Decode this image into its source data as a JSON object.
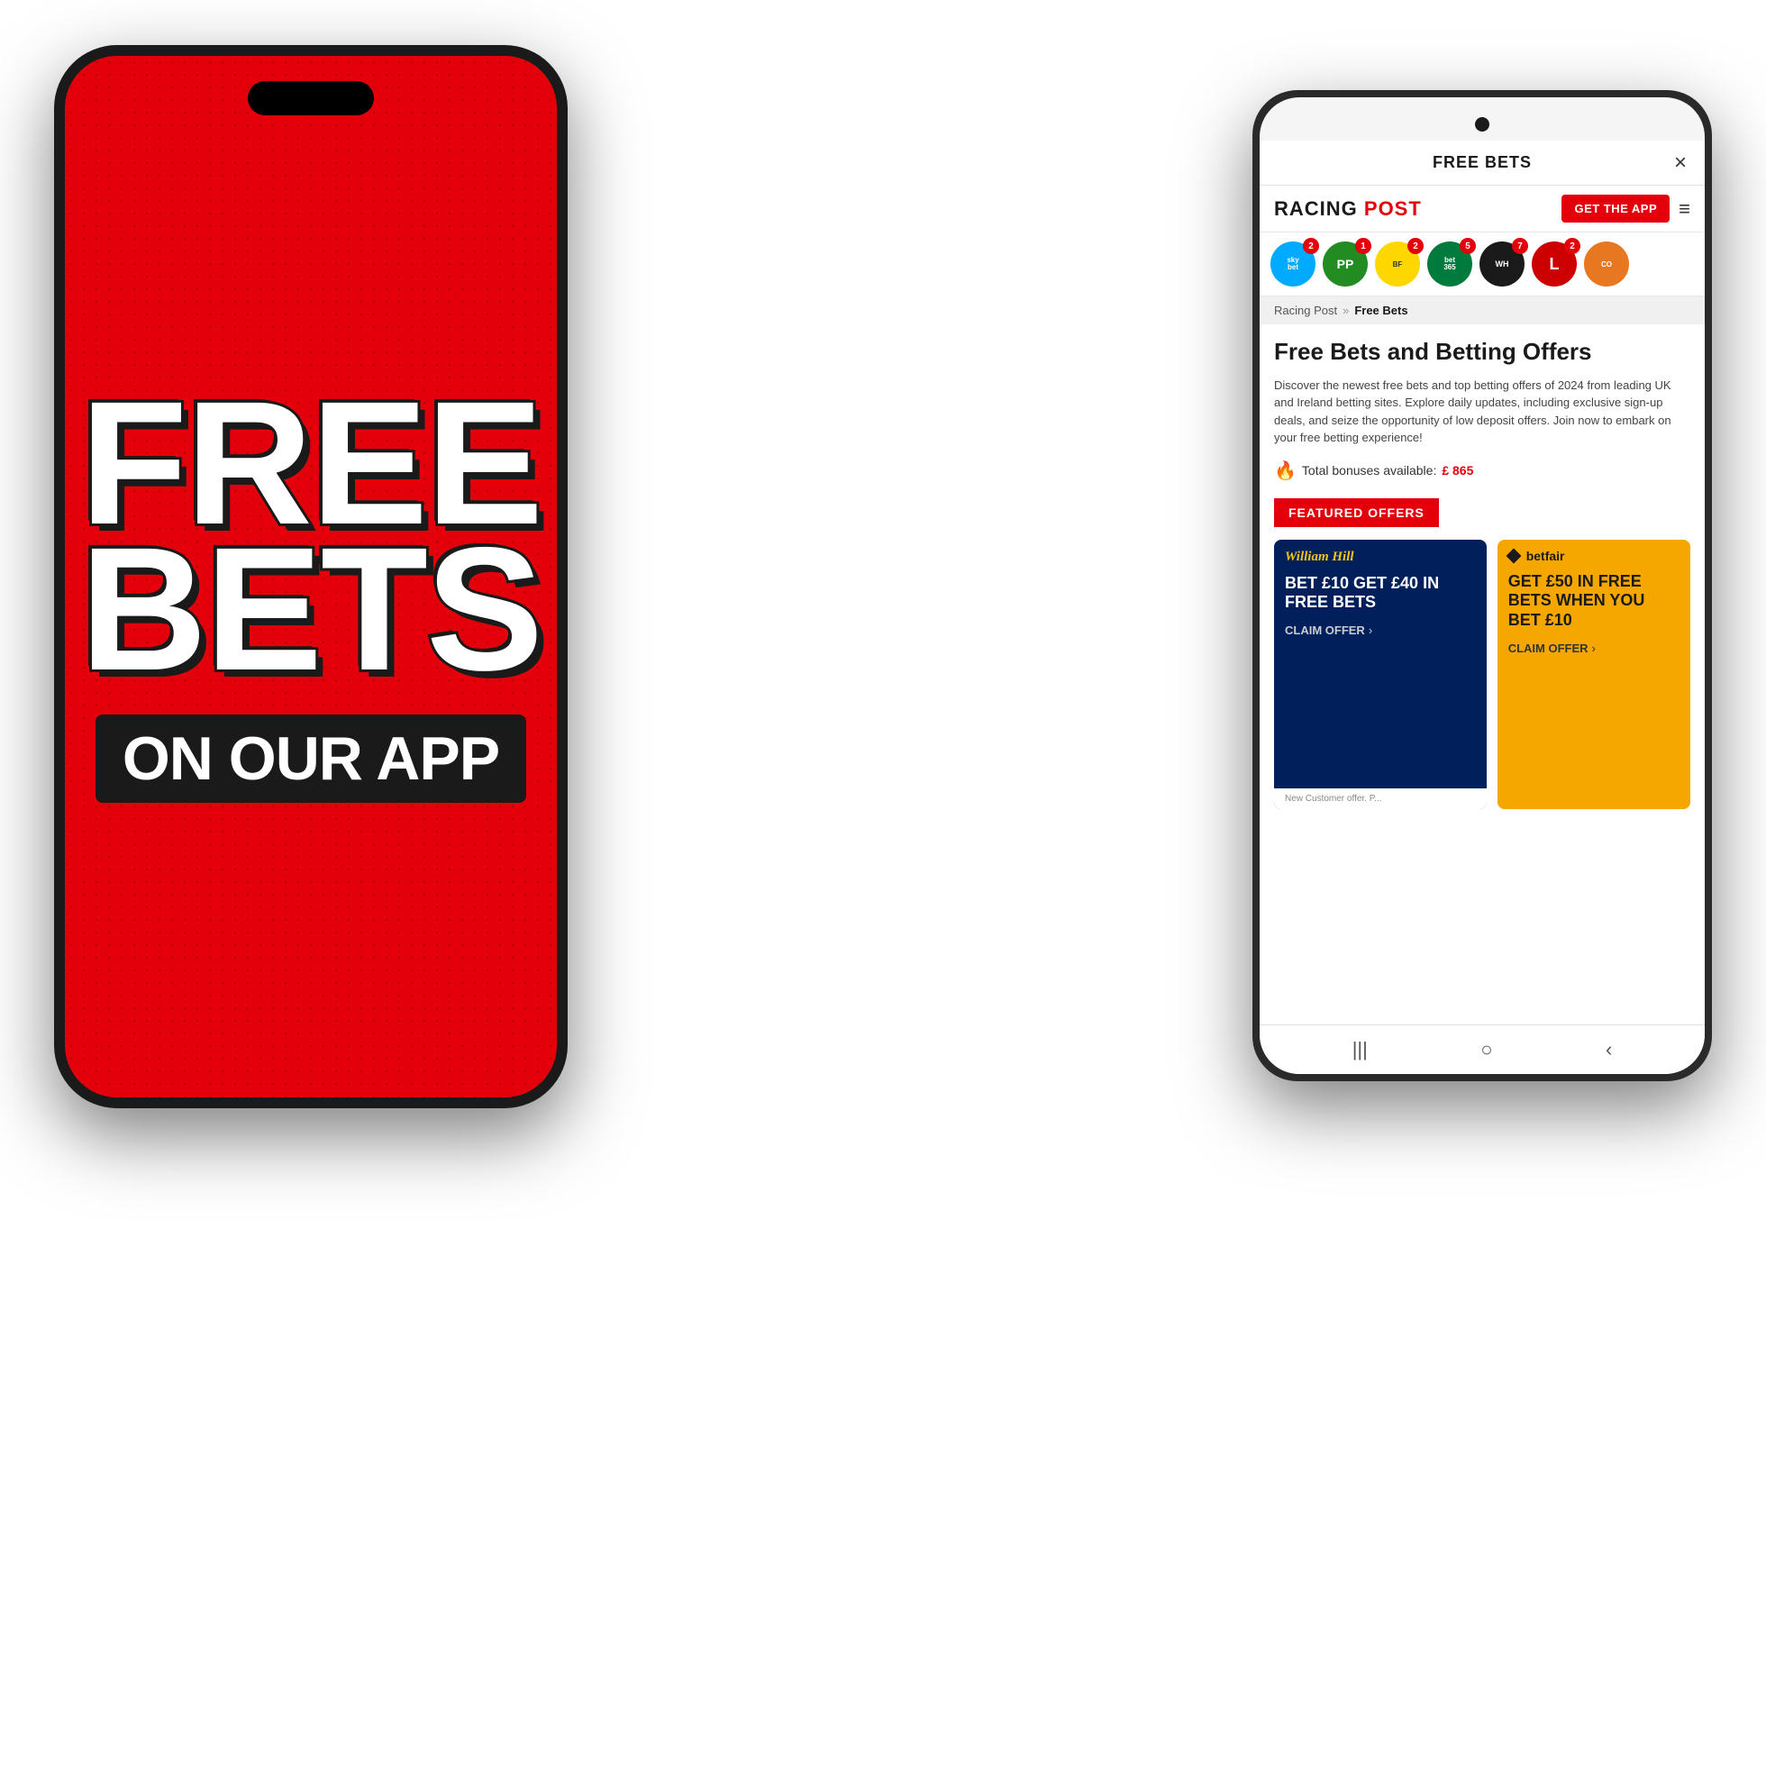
{
  "scene": {
    "background": "#ffffff"
  },
  "left_phone": {
    "background_color": "#e3000b",
    "line1": "FREE",
    "line2": "BETS",
    "line3": "ON OUR APP"
  },
  "right_phone": {
    "modal": {
      "title": "FREE BETS",
      "close_label": "×"
    },
    "navbar": {
      "brand": "RACING POST",
      "get_app_label": "GET THE APP",
      "menu_icon": "≡"
    },
    "bookies": [
      {
        "name": "Sky Bet",
        "short": "sky\nbet",
        "class": "bookie-sky",
        "badge": "2"
      },
      {
        "name": "Paddy Power",
        "short": "PP",
        "class": "bookie-pp",
        "badge": "1"
      },
      {
        "name": "Betfair",
        "short": "BF",
        "class": "bookie-betfair",
        "badge": "2"
      },
      {
        "name": "Bet365",
        "short": "bet\n365",
        "class": "bookie-bet365",
        "badge": "5"
      },
      {
        "name": "William Hill",
        "short": "WH",
        "class": "bookie-whill",
        "badge": "7"
      },
      {
        "name": "L",
        "short": "L",
        "class": "bookie-l",
        "badge": "2"
      },
      {
        "name": "Coral",
        "short": "CO",
        "class": "bookie-coral",
        "badge": ""
      }
    ],
    "breadcrumb": {
      "link": "Racing Post",
      "separator": "»",
      "current": "Free Bets"
    },
    "main": {
      "heading": "Free Bets and Betting Offers",
      "description": "Discover the newest free bets and top betting offers of 2024 from leading UK and Ireland betting sites. Explore daily updates, including exclusive sign-up deals, and seize the opportunity of low deposit offers. Join now to embark on your free betting experience!",
      "bonus_label": "Total bonuses available:",
      "bonus_amount": "£ 865",
      "featured_label": "FEATURED OFFERS"
    },
    "offers": [
      {
        "id": "whill",
        "logo": "William Hill",
        "title": "BET £10 GET £40 IN FREE BETS",
        "claim": "CLAIM OFFER",
        "footer": "New Customer offer. P..."
      },
      {
        "id": "betfair",
        "logo": "betfair",
        "title": "GET £50 IN FREE BETS WHEN YOU BET £10",
        "claim": "CLAIM OFFER",
        "footer": ""
      }
    ],
    "bottom_nav": {
      "icons": [
        "|||",
        "○",
        "<"
      ]
    }
  }
}
